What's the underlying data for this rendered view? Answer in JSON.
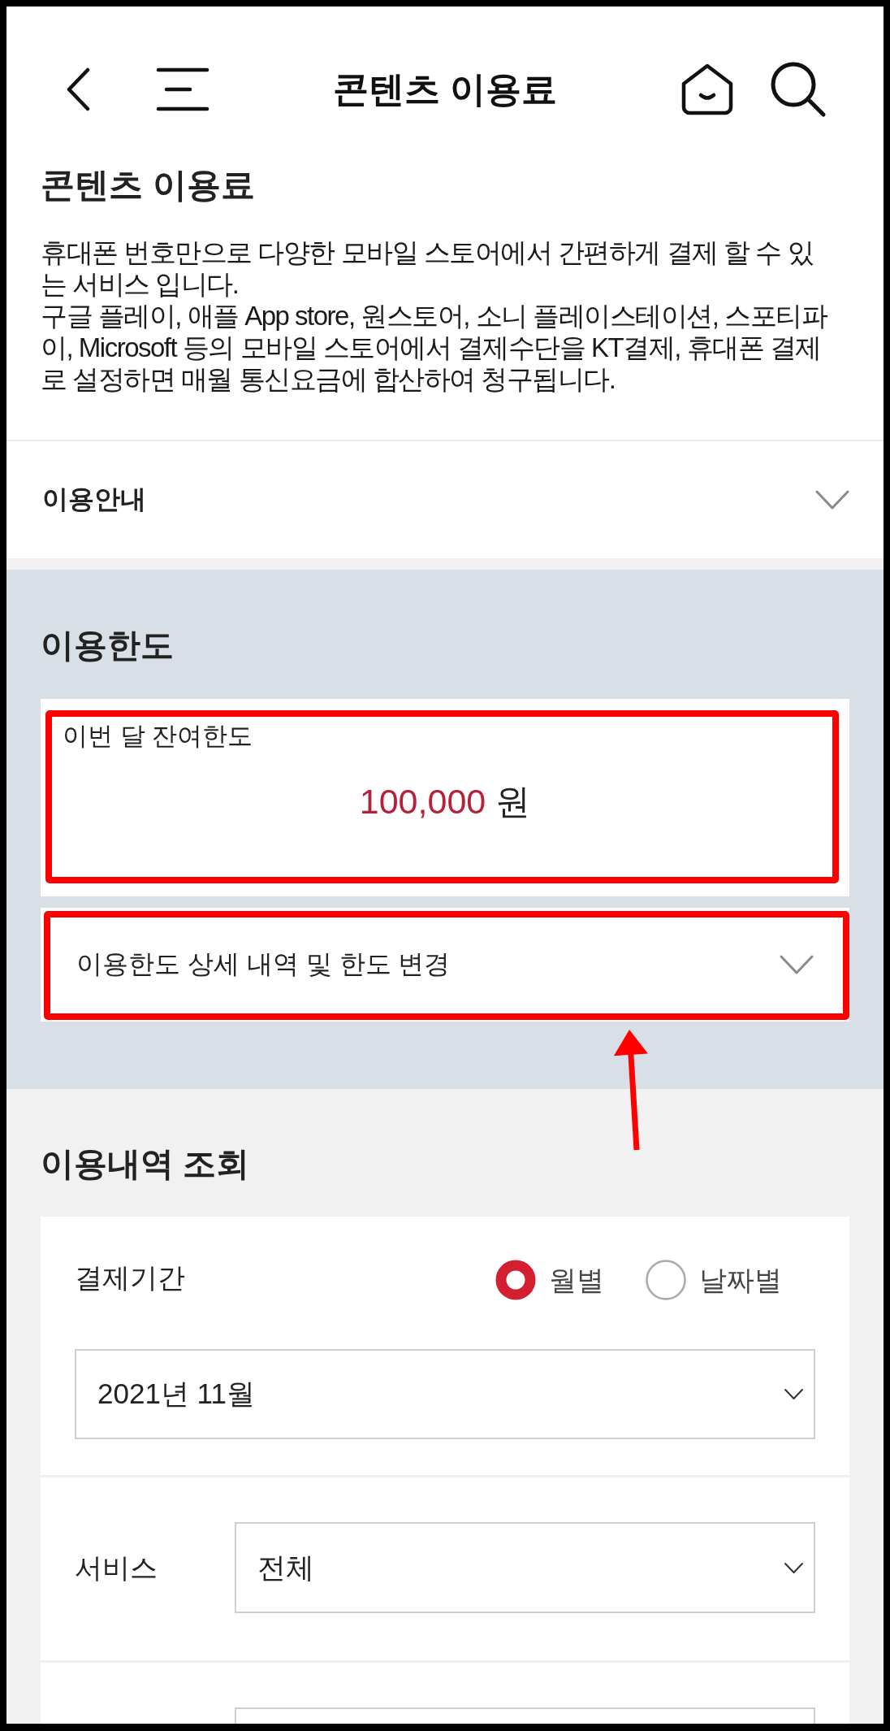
{
  "header": {
    "title": "콘텐츠 이용료"
  },
  "intro": {
    "title": "콘텐츠 이용료",
    "paragraphs": [
      "휴대폰 번호만으로 다양한 모바일 스토어에서 간편하게 결제 할 수 있는 서비스 입니다.",
      "구글 플레이, 애플 App store, 원스토어, 소니 플레이스테이션, 스포티파이, Microsoft 등의 모바일 스토어에서 결제수단을 KT결제, 휴대폰 결제로 설정하면 매월 통신요금에 합산하여 청구됩니다."
    ]
  },
  "guide": {
    "label": "이용안내",
    "expanded": false
  },
  "limit": {
    "title": "이용한도",
    "remaining": {
      "label": "이번 달 잔여한도",
      "amount": "100,000",
      "unit": "원",
      "highlighted": true
    },
    "detail": {
      "label": "이용한도 상세 내역 및 한도 변경",
      "expanded": false,
      "highlighted": true,
      "pointer_arrow": true
    }
  },
  "history": {
    "title": "이용내역 조회",
    "period": {
      "label": "결제기간",
      "options": [
        {
          "label": "월별",
          "selected": true
        },
        {
          "label": "날짜별",
          "selected": false
        }
      ],
      "value": "2021년 11월"
    },
    "filters": [
      {
        "kind": "select",
        "label": "서비스",
        "value": "전체"
      },
      {
        "kind": "select"
      }
    ]
  }
}
